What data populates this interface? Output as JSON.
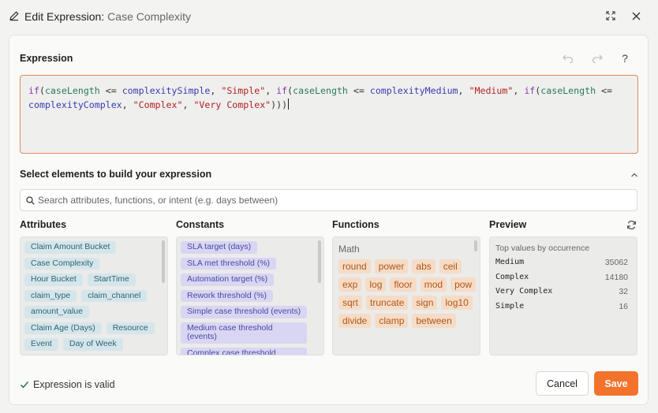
{
  "window": {
    "title": "Edit Expression:",
    "subtitle": "Case Complexity"
  },
  "expression": {
    "label": "Expression",
    "tokens": [
      {
        "t": "if",
        "k": "fn"
      },
      {
        "t": "(",
        "k": "op"
      },
      {
        "t": "caseLength",
        "k": "id"
      },
      {
        "t": " <= ",
        "k": "op"
      },
      {
        "t": "complexitySimple",
        "k": "const"
      },
      {
        "t": ", ",
        "k": "op"
      },
      {
        "t": "\"Simple\"",
        "k": "str"
      },
      {
        "t": ", ",
        "k": "op"
      },
      {
        "t": "if",
        "k": "fn"
      },
      {
        "t": "(",
        "k": "op"
      },
      {
        "t": "caseLength",
        "k": "id"
      },
      {
        "t": " <= ",
        "k": "op"
      },
      {
        "t": "complexityMedium",
        "k": "const"
      },
      {
        "t": ", ",
        "k": "op"
      },
      {
        "t": "\"Medium\"",
        "k": "str"
      },
      {
        "t": ", ",
        "k": "op"
      },
      {
        "t": "if",
        "k": "fn"
      },
      {
        "t": "(",
        "k": "op"
      },
      {
        "t": "caseLength",
        "k": "id"
      },
      {
        "t": " <= ",
        "k": "op"
      },
      {
        "t": "complexityComplex",
        "k": "const"
      },
      {
        "t": ", ",
        "k": "op"
      },
      {
        "t": "\"Complex\"",
        "k": "str"
      },
      {
        "t": ", ",
        "k": "op"
      },
      {
        "t": "\"Very Complex\"",
        "k": "str"
      },
      {
        "t": ")))",
        "k": "op"
      }
    ]
  },
  "builder": {
    "label": "Select elements to build your expression",
    "search_placeholder": "Search attributes, functions, or intent (e.g. days between)"
  },
  "attributes": {
    "header": "Attributes",
    "items": [
      "Claim Amount Bucket",
      "Case Complexity",
      "Hour Bucket",
      "StartTime",
      "claim_type",
      "claim_channel",
      "amount_value",
      "Claim Age (Days)",
      "Resource",
      "Event",
      "Day of Week"
    ]
  },
  "constants": {
    "header": "Constants",
    "items": [
      "SLA target (days)",
      "SLA met threshold (%)",
      "Automation target (%)",
      "Rework threshold (%)",
      "Simple case threshold (events)",
      "Medium case threshold (events)",
      "Complex case threshold"
    ]
  },
  "functions": {
    "header": "Functions",
    "group": "Math",
    "items": [
      "round",
      "power",
      "abs",
      "ceil",
      "exp",
      "log",
      "floor",
      "mod",
      "pow",
      "sqrt",
      "truncate",
      "sign",
      "log10",
      "divide",
      "clamp",
      "between"
    ]
  },
  "preview": {
    "header": "Preview",
    "subheader": "Top values by occurrence",
    "rows": [
      {
        "label": "Medium",
        "count": "35062"
      },
      {
        "label": "Complex",
        "count": "14180"
      },
      {
        "label": "Very Complex",
        "count": "32"
      },
      {
        "label": "Simple",
        "count": "16"
      }
    ]
  },
  "footer": {
    "status": "Expression is valid",
    "cancel_label": "Cancel",
    "save_label": "Save"
  },
  "colors": {
    "accent": "#f3722c",
    "valid": "#2e7d4f"
  }
}
